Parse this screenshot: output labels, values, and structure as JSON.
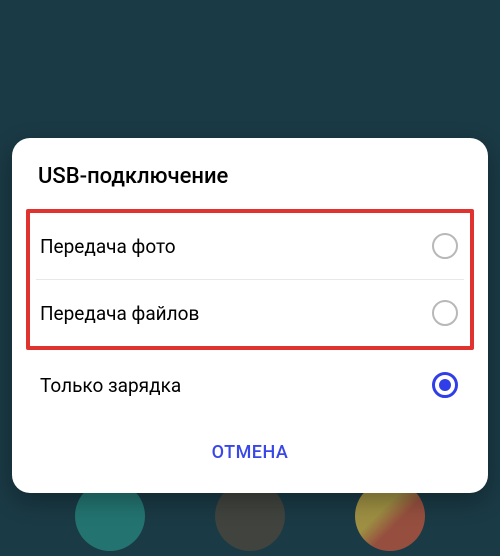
{
  "dialog": {
    "title": "USB-подключение",
    "options": [
      {
        "label": "Передача фото",
        "selected": false
      },
      {
        "label": "Передача файлов",
        "selected": false
      },
      {
        "label": "Только зарядка",
        "selected": true
      }
    ],
    "cancel_label": "ОТМЕНА"
  },
  "annotations": {
    "highlight_color": "#e0322f"
  },
  "colors": {
    "accent": "#2f3ee8",
    "background": "#1a3a45",
    "dialog_bg": "#ffffff"
  }
}
